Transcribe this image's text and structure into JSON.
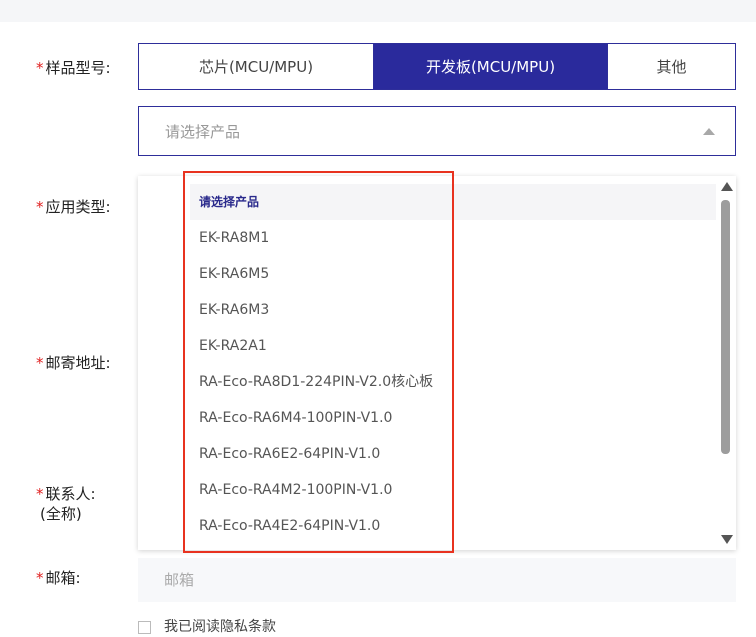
{
  "form": {
    "sample_model": {
      "label": "样品型号:",
      "options": [
        "芯片(MCU/MPU)",
        "开发板(MCU/MPU)",
        "其他"
      ],
      "selected_index": 1
    },
    "product_select": {
      "placeholder": "请选择产品",
      "dropdown": {
        "header": "请选择产品",
        "items": [
          "EK-RA8M1",
          "EK-RA6M5",
          "EK-RA6M3",
          "EK-RA2A1",
          "RA-Eco-RA8D1-224PIN-V2.0核心板",
          "RA-Eco-RA6M4-100PIN-V1.0",
          "RA-Eco-RA6E2-64PIN-V1.0",
          "RA-Eco-RA4M2-100PIN-V1.0",
          "RA-Eco-RA4E2-64PIN-V1.0"
        ]
      }
    },
    "app_type": {
      "label": "应用类型:"
    },
    "mail_address": {
      "label": "邮寄地址:"
    },
    "contact": {
      "label": "联系人:",
      "sublabel": "(全称)"
    },
    "email": {
      "label": "邮箱:",
      "placeholder": "邮箱"
    },
    "consent": {
      "text": "我已阅读隐私条款"
    },
    "required_mark": "*"
  },
  "colors": {
    "accent": "#2a2a9c",
    "required": "#e02020",
    "highlight": "#e8321f"
  },
  "icons": {
    "select_caret": "caret-up-icon",
    "scroll_up": "scroll-up-arrow-icon",
    "scroll_down": "scroll-down-arrow-icon"
  }
}
